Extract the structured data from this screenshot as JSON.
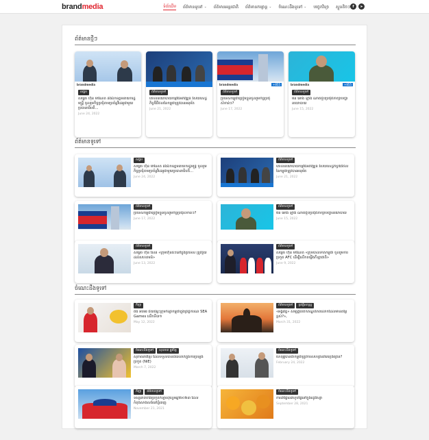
{
  "brand": {
    "part1": "brand",
    "part2": "media",
    "accent": "#e0242e"
  },
  "nav": [
    {
      "label": "ទំព័រដើម",
      "active": true,
      "caret": ""
    },
    {
      "label": "ព័ត៌មានទូទៅ",
      "active": false,
      "caret": "⌄"
    },
    {
      "label": "ព័ត៌មានអន្តរជាតិ",
      "active": false,
      "caret": ""
    },
    {
      "label": "ព័ត៌មានកម្សាន្ត",
      "active": false,
      "caret": "⌄"
    },
    {
      "label": "ចំណេះដឹងទូទៅ",
      "active": false,
      "caret": "⌄"
    },
    {
      "label": "បច្ចេកវិទ្យា",
      "active": false,
      "caret": ""
    },
    {
      "label": "ស្ទួនតិចៗ",
      "active": false,
      "caret": "⌄"
    }
  ],
  "social": [
    {
      "name": "facebook-icon",
      "glyph": "f"
    },
    {
      "name": "telegram-icon",
      "glyph": "➤"
    }
  ],
  "sections": {
    "latest": "ព័ត៌មានថ្មីៗ",
    "general": "ព័ត៌មានទូទៅ",
    "knowledge": "ចំណេះដឹងទូទៅ"
  },
  "latest": [
    {
      "tags": [
        "សង្គម"
      ],
      "title": "សម្ដេច ហ៊ុន ម៉ាណែត និងឯកឧត្ដមនាយករដ្ឋមន្ត្រី ចូលរួមកិច្ចប្រជុំតាមប្រព័ន្ធវីដេអូជាមួយប្រធានាធិបតី...",
      "date": "June 24, 2022"
    },
    {
      "tags": [
        "ព័ត៌មានទូទៅ"
      ],
      "title": "គោលនយោបាយកម្មវិធីអភិវឌ្ឍន៍ វិស័យសេដ្ឋកិច្ចឌីជីថលនៃកម្ពុជាត្រូវបានអនុម័ត",
      "date": "June 21, 2022"
    },
    {
      "tags": [
        "ព័ត៌មានទូទៅ"
      ],
      "title": "ប្រទេសកម្ពុជាត្រៀមខ្លួនចូលរួមកិច្ចប្រជុំសំខាន់ៗ?",
      "date": "June 17, 2022"
    },
    {
      "tags": [
        "ព័ត៌មានទូទៅ"
      ],
      "title": "មីន អោង ឡាំង ណាត់ជួបប្រជុំពិភាក្សាបញ្ហានយោបាយ",
      "date": "June 15, 2022"
    }
  ],
  "general": [
    {
      "tags": [
        "សង្គម"
      ],
      "title": "សម្ដេច ហ៊ុន ម៉ាណែត និងឯកឧត្ដមនាយករដ្ឋមន្ត្រី ចូលរួមកិច្ចប្រជុំតាមប្រព័ន្ធវីដេអូជាមួយប្រធានាធិបតី...",
      "date": "June 24, 2022"
    },
    {
      "tags": [
        "ព័ត៌មានទូទៅ"
      ],
      "title": "គោលនយោបាយកម្មវិធីអភិវឌ្ឍន៍ វិស័យសេដ្ឋកិច្ចឌីជីថលនៃកម្ពុជាត្រូវបានអនុម័ត",
      "date": "June 21, 2022"
    },
    {
      "tags": [
        "ព័ត៌មានទូទៅ"
      ],
      "title": "ប្រទេសកម្ពុជាត្រៀមខ្លួនចូលរួមកិច្ចប្រជុំសំខាន់ៗ?",
      "date": "June 17, 2022"
    },
    {
      "tags": [
        "ព័ត៌មានទូទៅ"
      ],
      "title": "មីន អោង ឡាំង ណាត់ជួបប្រជុំពិភាក្សាបញ្ហានយោបាយ",
      "date": "June 15, 2022"
    },
    {
      "tags": [
        "ព័ត៌មានទូទៅ"
      ],
      "title": "សម្ដេច ហ៊ុន សែន «ក្រុមហ៊ុនធំៗនៅក្នុងប្រទេស ត្រូវជួយដល់សហគមន៍»",
      "date": "June 13, 2022"
    },
    {
      "tags": [
        "ព័ត៌មានទូទៅ"
      ],
      "title": "សម្ដេច ហ៊ុន ម៉ាណែត «ក្រុមបាល់ទាត់កម្ពុជា ចូលរួមការប្រកួត AFC ដើម្បីលើកតម្កើងកីឡាជាតិ»",
      "date": "June 9, 2022"
    }
  ],
  "knowledge": [
    {
      "tags": [
        "កីឡា"
      ],
      "title": "ពិធី អបអរ ជ័យជម្នះក្រុមកីឡាកម្ពុជាក្នុងព្រឹត្តិការណ៍ SEA Games លើកទី៣១",
      "date": "May 12, 2022"
    },
    {
      "tags": [
        "ព័ត៌មានទូទៅ",
        "ប្រវត្តិសាស្ត្រ"
      ],
      "title": "«អង្គរវត្ត» សម្បត្តិបេតិកភណ្ឌពិភពលោកដែលមានតម្លៃខ្ពស់?», ",
      "date": "March 31, 2022"
    },
    {
      "tags": [
        "ចំណេះដឹងទូទៅ",
        "សុខភាព ផ្លូវចិត្ត"
      ],
      "title": "សុភាពនារីខ្មែរ ដែលទទួលបានជ័យលាភីក្នុងការប្រឡងប្រកួត (NiE)",
      "date": "March 7, 2022"
    },
    {
      "tags": [
        "ចំណេះដឹងទូទៅ"
      ],
      "title": "ហេតុអ្វីបានជាកម្ពុជាត្រូវការសហគ្រិនវ័យក្មេងច្រើន?",
      "date": "February 24, 2022"
    },
    {
      "tags": [
        "កីឡា",
        "ព័ត៌មានទូទៅ"
      ],
      "title": "ទស្សនាទីតាំងប្រកួតកីឡាស៊ីហ្គេមឆ្នាំ២០២៣ ដែលកំពុងសាងសង់នៅភ្នំពេញ",
      "date": "November 21, 2021"
    },
    {
      "tags": [
        "ចំណេះដឹងទូទៅ"
      ],
      "title": "ការដាំផ្លែឈើហូបផ្លែនៅក្នុងរដូវវស្សា",
      "date": "September 28, 2021"
    }
  ]
}
